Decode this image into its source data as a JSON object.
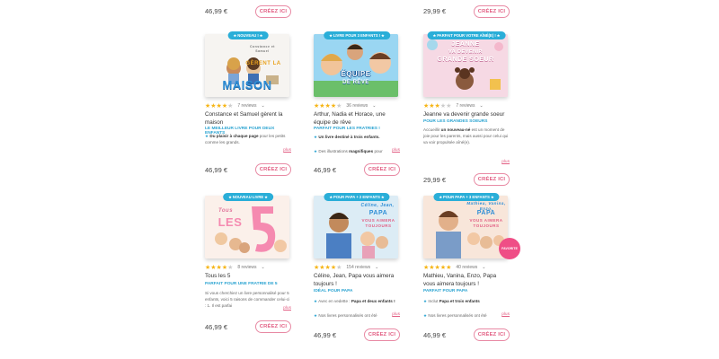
{
  "top": {
    "cells": [
      {
        "price": "46,99 €",
        "button": "CRÉEZ ICI"
      },
      {
        "price": "29,99 €",
        "button": "CRÉEZ ICI"
      }
    ]
  },
  "products": [
    {
      "badge": "NOUVEAU !",
      "cover_title": "GÈRENT LA MAISON",
      "cover_small": "Constance et Samuel",
      "stars": 4,
      "reviews": "7 reviews",
      "title": "Constance et Samuel gèrent la maison",
      "subtitle": "LE MEILLEUR LIVRE POUR DEUX ENFANTS",
      "desc_bold": "Du plaisir à chaque page",
      "desc": " pour les petits comme les grands.",
      "more": "plus",
      "price": "46,99 €",
      "button": "CRÉEZ ICI"
    },
    {
      "badge": "LIVRE POUR 3 ENFANTS !",
      "cover_title": "UNE ÉQUIPE DE RÊVE",
      "stars": 4,
      "reviews": "36 reviews",
      "title": "Arthur, Nadia et Horace, une équipe de rêve",
      "subtitle": "PARFAIT POUR LES FRATRIES !",
      "desc_bold": "Un livre destiné à trois enfants.",
      "desc2_pre": "Des illustrations ",
      "desc2_bold": "magnifiques",
      "desc2": " pour",
      "more": "plus",
      "price": "46,99 €",
      "button": "CRÉEZ ICI"
    },
    {
      "badge": "PARFAIT POUR VOTRE AÎNÉ(E) !",
      "cover_title": "JEANNE VA DEVENIR GRANDE SOEUR",
      "stars": 3,
      "reviews": "7 reviews",
      "title": "Jeanne va devenir grande soeur",
      "subtitle": "POUR LES GRANDES SOEURS",
      "desc_pre": "Accueillir ",
      "desc_bold": "un nouveau-né",
      "desc": " est un moment de joie pour les parents, mais aussi pour celui qui va voir propulsée aîné(e).",
      "more": "plus",
      "price": "29,99 €",
      "button": "CRÉEZ ICI"
    },
    {
      "badge": "NOUVEAU LIVRE",
      "cover_title": "TOUS LES 5",
      "stars": 4,
      "reviews": "8 reviews",
      "title": "Tous les 5",
      "subtitle": "PARFAIT POUR UNE FRATRIE DE 5",
      "desc": "Si vous cherchiez un livre personnalisé pour 5 enfants, voici 5 raisons de commander celui-ci : 1. Il est parfai",
      "more": "plus",
      "price": "46,99 €",
      "button": "CRÉEZ ICI"
    },
    {
      "badge": "POUR PAPA + 2 ENFANTS",
      "cover_title": "PAPA NOUS T'AIMERA TOUJOURS",
      "stars": 4,
      "reviews": "154 reviews",
      "title": "Céline, Jean, Papa vous aimera toujours !",
      "subtitle": "IDÉAL POUR PAPA",
      "desc_pre": "Avec en vedette : ",
      "desc_bold": "Papa et deux enfants !",
      "desc2": "Nos livres personnalisés ont été",
      "more": "plus",
      "price": "46,99 €",
      "button": "CRÉEZ ICI"
    },
    {
      "badge": "POUR PAPA + 3 ENFANTS",
      "cover_title": "PAPA VOUS AIMERA TOUJOURS",
      "best": "FAVORITE",
      "stars": 5,
      "reviews": "40 reviews",
      "title": "Mathieu, Vanina, Enzo, Papa vous aimera toujours !",
      "subtitle": "PARFAIT POUR PAPA",
      "desc_pre": "Inclut ",
      "desc_bold": "Papa et trois enfants",
      "desc2": "Nos livres personnalisés ont été",
      "more": "plus",
      "price": "46,99 €",
      "button": "CRÉEZ ICI"
    }
  ],
  "colors": {
    "accent_blue": "#2aa3d1",
    "accent_pink": "#e25d82",
    "star": "#f6b515"
  }
}
